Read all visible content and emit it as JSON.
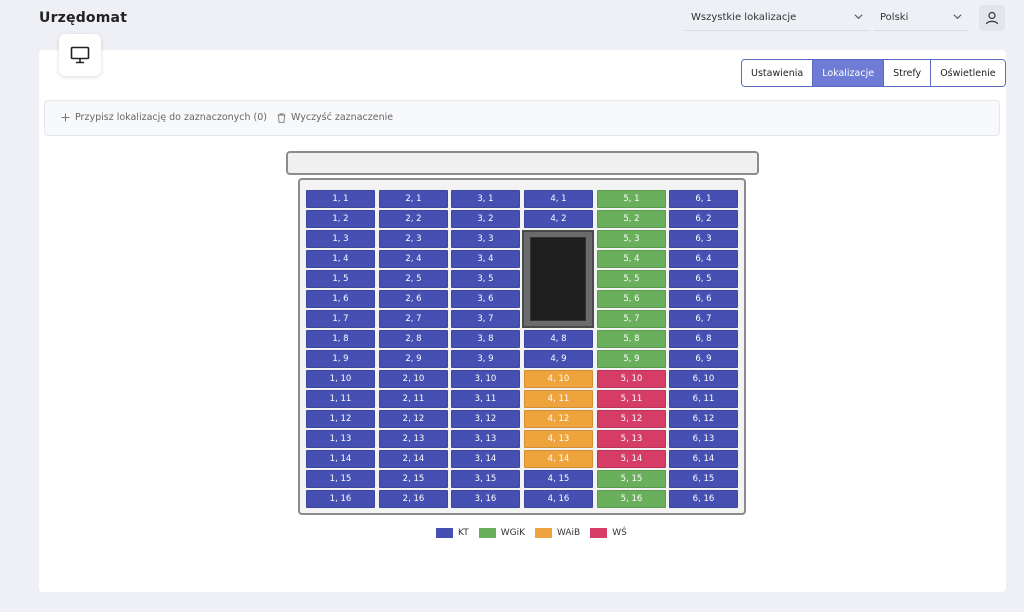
{
  "app": {
    "title": "Urzędomat"
  },
  "header": {
    "location_select": "Wszystkie lokalizacje",
    "language_select": "Polski"
  },
  "tabs": [
    "Ustawienia",
    "Lokalizacje",
    "Strefy",
    "Oświetlenie"
  ],
  "active_tab": "Lokalizacje",
  "toolbar": {
    "assign_label": "Przypisz lokalizację do zaznaczonych (0)",
    "clear_label": "Wyczyść zaznaczenie"
  },
  "colors": {
    "KT": "#4650b2",
    "WGiK": "#6aaf5c",
    "WAiB": "#efa33c",
    "WŚ": "#d63d66"
  },
  "legend": [
    {
      "key": "KT",
      "label": "KT"
    },
    {
      "key": "WGiK",
      "label": "WGiK"
    },
    {
      "key": "WAiB",
      "label": "WAiB"
    },
    {
      "key": "WŚ",
      "label": "WŚ"
    }
  ],
  "columns": [
    {
      "col": 1,
      "rows": [
        "KT",
        "KT",
        "KT",
        "KT",
        "KT",
        "KT",
        "KT",
        "KT",
        "KT",
        "KT",
        "KT",
        "KT",
        "KT",
        "KT",
        "KT",
        "KT"
      ]
    },
    {
      "col": 2,
      "rows": [
        "KT",
        "KT",
        "KT",
        "KT",
        "KT",
        "KT",
        "KT",
        "KT",
        "KT",
        "KT",
        "KT",
        "KT",
        "KT",
        "KT",
        "KT",
        "KT"
      ]
    },
    {
      "col": 3,
      "rows": [
        "KT",
        "KT",
        "KT",
        "KT",
        "KT",
        "KT",
        "KT",
        "KT",
        "KT",
        "KT",
        "KT",
        "KT",
        "KT",
        "KT",
        "KT",
        "KT"
      ]
    },
    {
      "col": 4,
      "rows": [
        "KT",
        "KT",
        null,
        null,
        null,
        null,
        null,
        "KT",
        "KT",
        "WAiB",
        "WAiB",
        "WAiB",
        "WAiB",
        "WAiB",
        "KT",
        "KT"
      ]
    },
    {
      "col": 5,
      "rows": [
        "WGiK",
        "WGiK",
        "WGiK",
        "WGiK",
        "WGiK",
        "WGiK",
        "WGiK",
        "WGiK",
        "WGiK",
        "WŚ",
        "WŚ",
        "WŚ",
        "WŚ",
        "WŚ",
        "WGiK",
        "WGiK"
      ]
    },
    {
      "col": 6,
      "rows": [
        "KT",
        "KT",
        "KT",
        "KT",
        "KT",
        "KT",
        "KT",
        "KT",
        "KT",
        "KT",
        "KT",
        "KT",
        "KT",
        "KT",
        "KT",
        "KT"
      ]
    }
  ]
}
